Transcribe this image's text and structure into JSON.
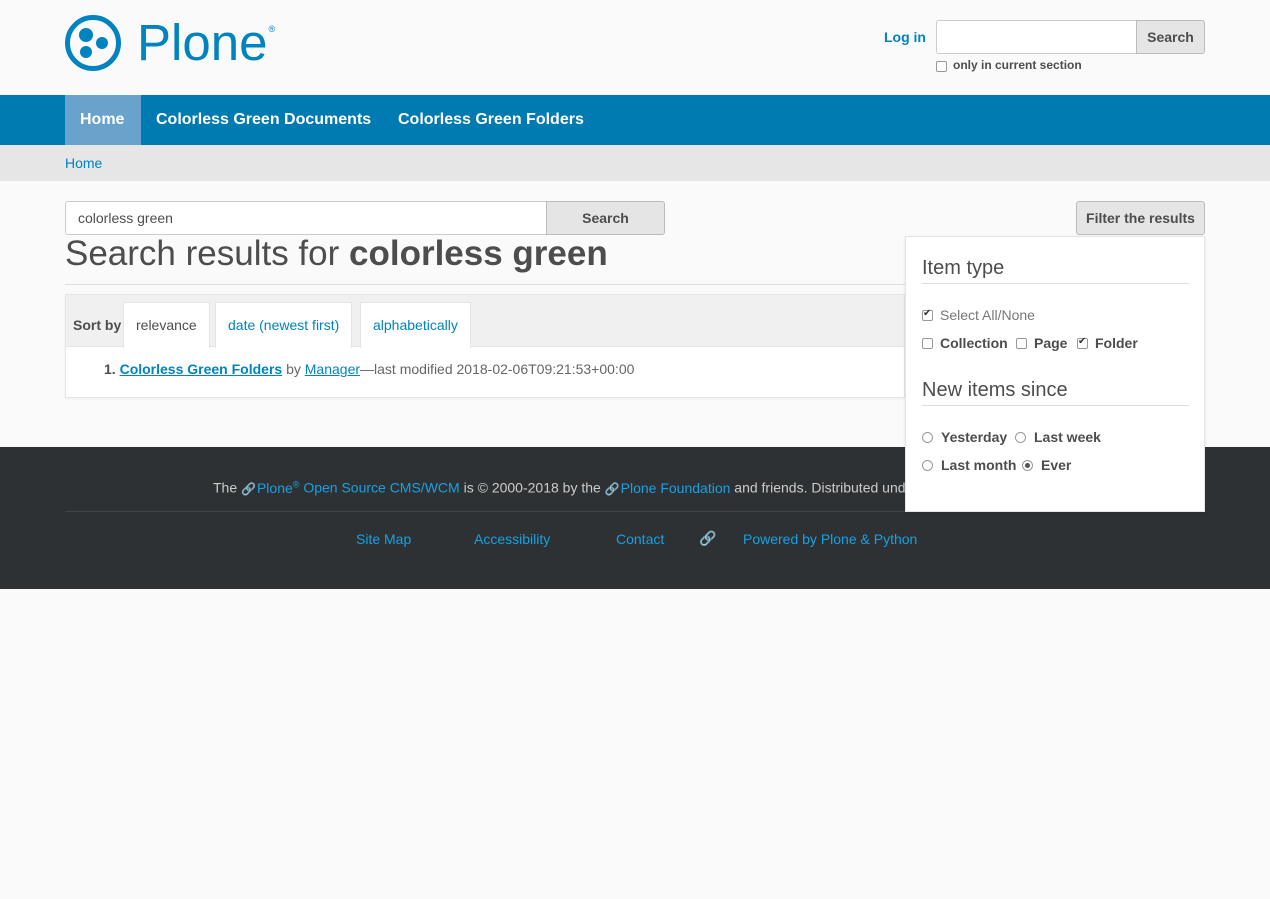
{
  "header": {
    "logo_text": "Plone",
    "logo_mark": "®",
    "login_label": "Log in",
    "search_value": "",
    "search_button": "Search",
    "section_only_label": "only in current section"
  },
  "nav": {
    "items": [
      {
        "label": "Home",
        "active": true
      },
      {
        "label": "Colorless Green Documents",
        "active": false
      },
      {
        "label": "Colorless Green Folders",
        "active": false
      }
    ]
  },
  "breadcrumb": {
    "home": "Home"
  },
  "search": {
    "query": "colorless green",
    "button": "Search",
    "filter_button": "Filter the results",
    "title_prefix": "Search results for",
    "title_query": "colorless green"
  },
  "sort": {
    "label": "Sort by",
    "options": [
      "relevance",
      "date (newest first)",
      "alphabetically"
    ],
    "active": "relevance"
  },
  "results": [
    {
      "number": "1.",
      "title": "Colorless Green Folders",
      "by": "by",
      "author": "Manager",
      "modified": "—last modified 2018-02-06T09:21:53+00:00"
    }
  ],
  "filter": {
    "item_type_heading": "Item type",
    "select_all": "Select All/None",
    "types": [
      {
        "label": "Collection",
        "checked": false
      },
      {
        "label": "Page",
        "checked": false
      },
      {
        "label": "Folder",
        "checked": true
      }
    ],
    "since_heading": "New items since",
    "since": [
      {
        "label": "Yesterday",
        "checked": false
      },
      {
        "label": "Last week",
        "checked": false
      },
      {
        "label": "Last month",
        "checked": false
      },
      {
        "label": "Ever",
        "checked": true
      }
    ]
  },
  "footer": {
    "the": "The",
    "plone": "Plone",
    "reg": "®",
    "cms": "Open Source CMS/WCM",
    "is": "is",
    "copy": "©",
    "years": "2000-2018 by the",
    "foundation": "Plone Foundation",
    "rest": "and friends. Distributed under",
    "links": [
      "Site Map",
      "Accessibility",
      "Contact",
      "Powered by Plone & Python"
    ]
  },
  "colors": {
    "brand": "#0083be",
    "nav_bg": "#007bb1",
    "nav_active": "#69a3cb",
    "footer_bg": "#2e3133",
    "footer_link": "#16a1e3"
  },
  "icons": [
    "plone-logo-icon",
    "link-icon",
    "checkbox",
    "radio"
  ]
}
